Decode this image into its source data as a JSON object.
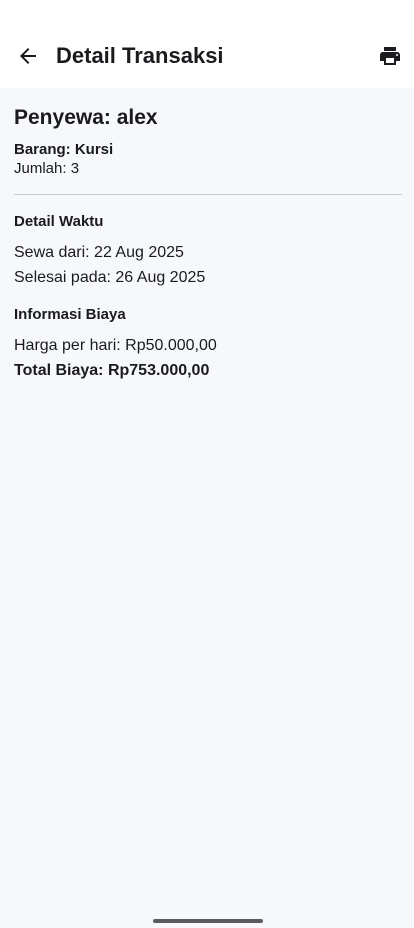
{
  "app_bar": {
    "title": "Detail Transaksi",
    "back_icon": "arrow-back-icon",
    "print_icon": "printer-icon"
  },
  "rental": {
    "renter": "Penyewa: alex",
    "item": "Barang: Kursi",
    "quantity": "Jumlah: 3"
  },
  "time_section": {
    "heading": "Detail Waktu",
    "start": "Sewa dari: 22 Aug 2025",
    "end": "Selesai pada: 26 Aug 2025"
  },
  "cost_section": {
    "heading": "Informasi Biaya",
    "price_per_day": "Harga per hari: Rp50.000,00",
    "total": "Total Biaya: Rp753.000,00"
  },
  "colors": {
    "background": "#f7f8fb",
    "app_bar": "#ffffff",
    "text": "#1b1b1f",
    "divider": "#c7c7cc"
  }
}
